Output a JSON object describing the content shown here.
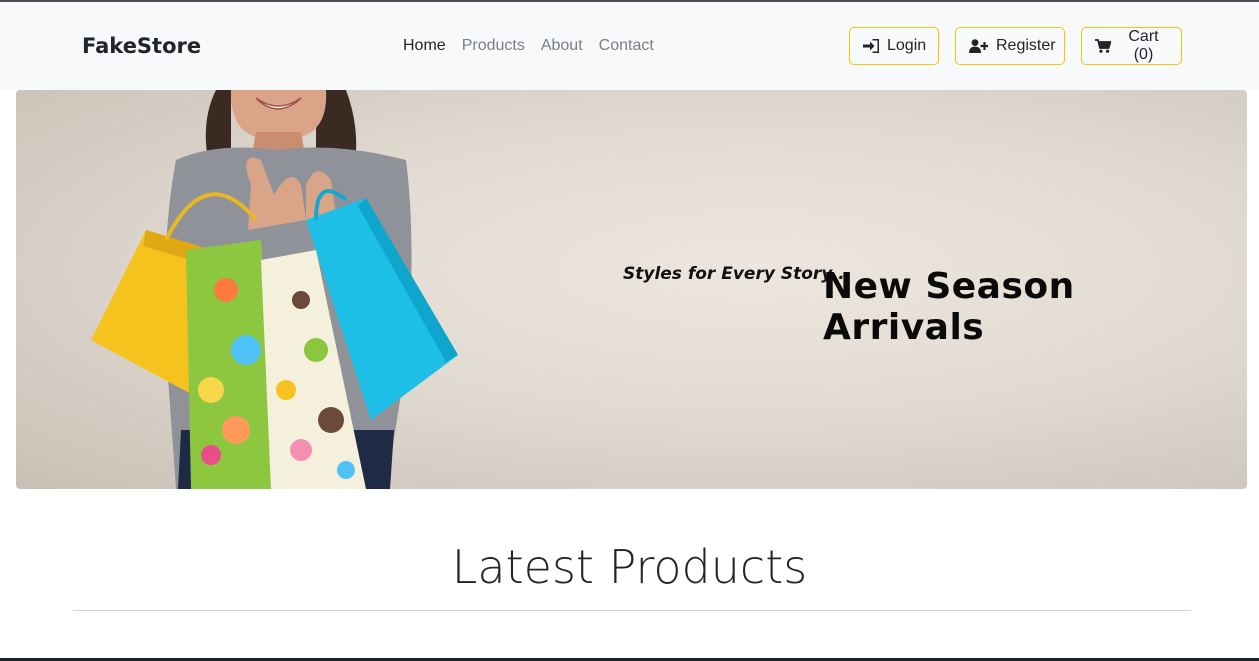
{
  "navbar": {
    "brand": "FakeStore",
    "links": [
      {
        "label": "Home"
      },
      {
        "label": "Products"
      },
      {
        "label": "About"
      },
      {
        "label": "Contact"
      }
    ],
    "login_label": "Login",
    "register_label": "Register",
    "cart_label": "Cart (0)"
  },
  "hero": {
    "tagline": "Styles for Every Story .",
    "title": "New Season Arrivals"
  },
  "section": {
    "title": "Latest Products"
  },
  "colors": {
    "accent_border": "#ffc107",
    "navbar_bg": "#f8f9fa",
    "link_muted": "#7a7f85"
  },
  "icons": {
    "login": "sign-in-icon",
    "register": "user-plus-icon",
    "cart": "shopping-cart-icon"
  }
}
